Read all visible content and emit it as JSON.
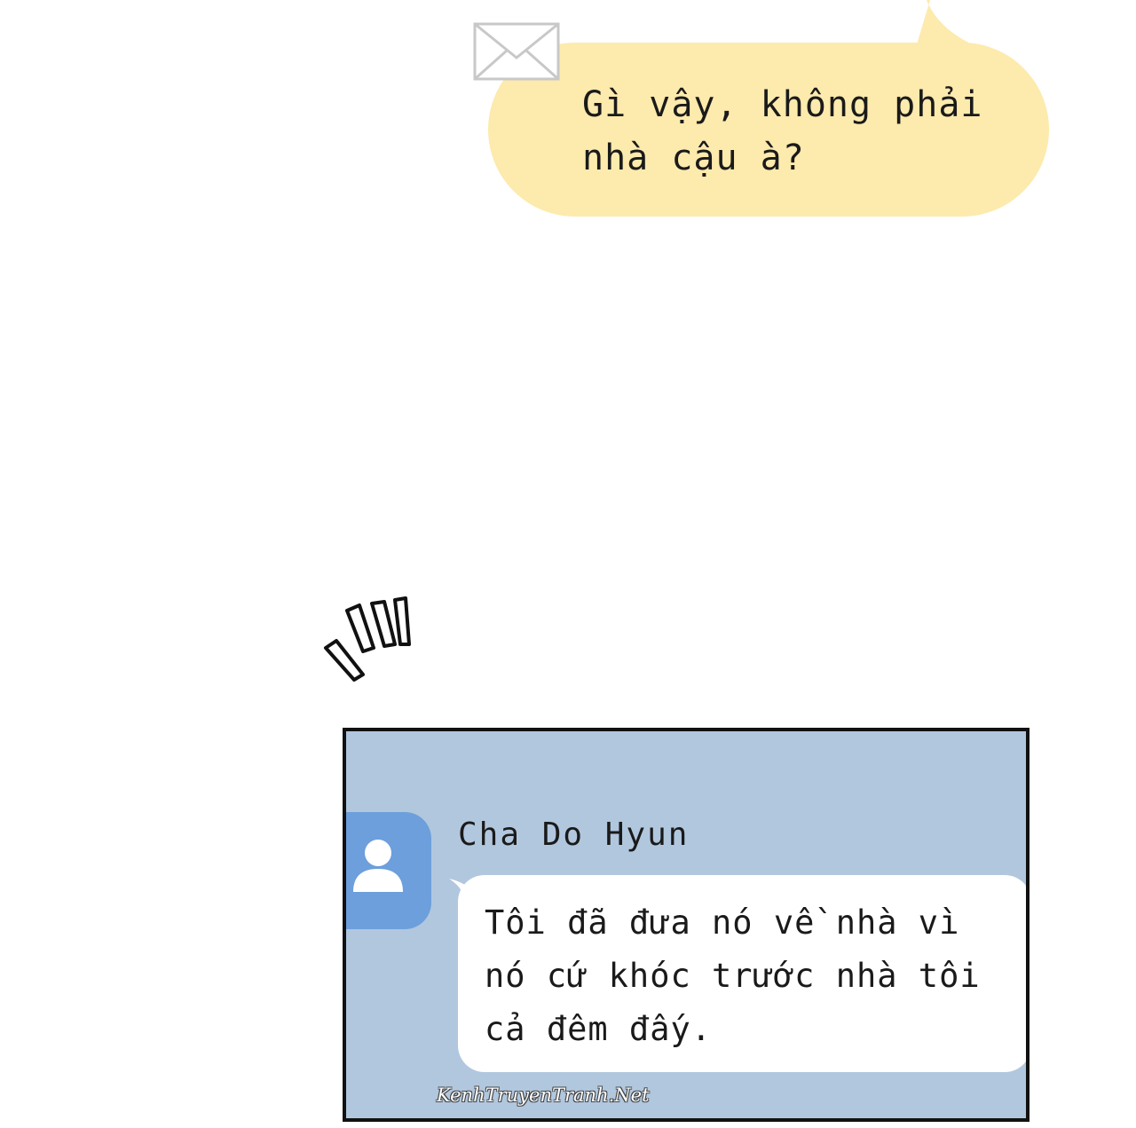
{
  "top_message": {
    "text": "Gì vậy, không phải\nnhà cậu à?",
    "icon": "mail-icon",
    "bubble_color": "#fdeaad"
  },
  "chat": {
    "background_color": "#b1c7de",
    "avatar_color": "#6c9fdb",
    "avatar_icon": "user-icon",
    "sender_name": "Cha Do Hyun",
    "message": "Tôi đã đưa nó về nhà vì\nnó cứ khóc trước nhà tôi\ncả đêm đấy."
  },
  "watermark": "KenhTruyenTranh.Net"
}
